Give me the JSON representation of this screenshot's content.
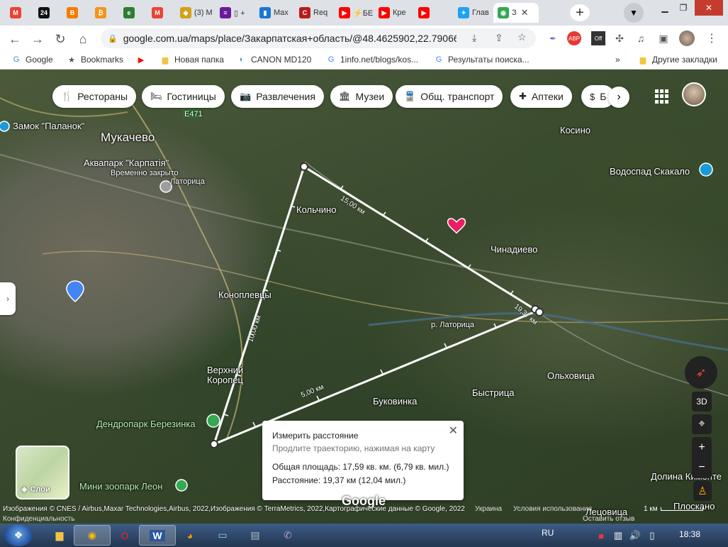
{
  "browser": {
    "tabs": [
      {
        "title": "",
        "favicon": "gmail-icon",
        "color": "#ea4335",
        "glyph": "M"
      },
      {
        "title": "",
        "favicon": "site-24-icon",
        "color": "#111111",
        "glyph": "24"
      },
      {
        "title": "",
        "favicon": "blogger-icon",
        "color": "#f57c00",
        "glyph": "B"
      },
      {
        "title": "",
        "favicon": "bitcoin-icon",
        "color": "#f7931a",
        "glyph": "₿"
      },
      {
        "title": "",
        "favicon": "e-icon",
        "color": "#2e7d32",
        "glyph": "e"
      },
      {
        "title": "",
        "favicon": "gmail-icon",
        "color": "#ea4335",
        "glyph": "M"
      },
      {
        "title": "(3) M",
        "favicon": "shield-icon",
        "color": "#d4a017",
        "glyph": "◆"
      },
      {
        "title": "▯ +",
        "favicon": "list-icon",
        "color": "#6a1b9a",
        "glyph": "≡"
      },
      {
        "title": "Max",
        "favicon": "book-icon",
        "color": "#1976d2",
        "glyph": "▮"
      },
      {
        "title": "Req",
        "favicon": "c-icon",
        "color": "#b71c1c",
        "glyph": "C"
      },
      {
        "title": "⚡БЕЛ",
        "favicon": "youtube-icon",
        "color": "#ff0000",
        "glyph": "▶"
      },
      {
        "title": "Кре",
        "favicon": "youtube-icon",
        "color": "#ff0000",
        "glyph": "▶"
      },
      {
        "title": "",
        "favicon": "youtube-icon",
        "color": "#ff0000",
        "glyph": "▶"
      },
      {
        "title": "Глав",
        "favicon": "twitter-icon",
        "color": "#1da1f2",
        "glyph": "✦"
      },
      {
        "title": "З",
        "favicon": "maps-icon",
        "color": "#34a853",
        "glyph": "◉",
        "active": true
      }
    ],
    "url": "google.com.ua/maps/place/Закарпатская+область/@48.4625902,22.79066...",
    "bookmarks": [
      {
        "label": "Google",
        "icon": "google-icon",
        "color": "#4285f4",
        "glyph": "G"
      },
      {
        "label": "Bookmarks",
        "icon": "star-icon",
        "color": "#555555",
        "glyph": "★"
      },
      {
        "label": "",
        "icon": "youtube-icon",
        "color": "#ff0000",
        "glyph": "▶"
      },
      {
        "label": "Новая папка",
        "icon": "folder-icon",
        "color": "#f4c542",
        "glyph": "▆"
      },
      {
        "label": "CANON MD120",
        "icon": "canon-icon",
        "color": "#29a3e0",
        "glyph": "◐"
      },
      {
        "label": "1info.net/blogs/kos...",
        "icon": "google-icon",
        "color": "#4285f4",
        "glyph": "G"
      },
      {
        "label": "Результаты поиска...",
        "icon": "google-icon",
        "color": "#4285f4",
        "glyph": "G"
      }
    ],
    "bookmarks_more": "»",
    "other_bookmarks": "Другие закладки"
  },
  "map": {
    "chips": [
      {
        "label": "Рестораны",
        "icon": "fork-knife-icon",
        "glyph": "🍴"
      },
      {
        "label": "Гостиницы",
        "icon": "bed-icon",
        "glyph": "🛏"
      },
      {
        "label": "Развлечения",
        "icon": "camera-icon",
        "glyph": "📷"
      },
      {
        "label": "Музеи",
        "icon": "museum-icon",
        "glyph": "🏛"
      },
      {
        "label": "Общ. транспорт",
        "icon": "train-icon",
        "glyph": "🚆"
      },
      {
        "label": "Аптеки",
        "icon": "pharmacy-icon",
        "glyph": "✚"
      },
      {
        "label": "Б",
        "icon": "atm-icon",
        "glyph": "$"
      }
    ],
    "places": [
      {
        "name": "Замок \"Паланок\"",
        "cls": ""
      },
      {
        "name": "Мукачево",
        "cls": "big"
      },
      {
        "name": "Аквапарк \"Карпатія\"",
        "cls": ""
      },
      {
        "name": "Временно закрыто",
        "cls": "small"
      },
      {
        "name": "Латорица",
        "cls": "small"
      },
      {
        "name": "Кольчино",
        "cls": ""
      },
      {
        "name": "Чинадиево",
        "cls": ""
      },
      {
        "name": "Косино",
        "cls": ""
      },
      {
        "name": "Водоспад Скакало",
        "cls": ""
      },
      {
        "name": "Коноплевцы",
        "cls": ""
      },
      {
        "name": "р. Латорица",
        "cls": "small"
      },
      {
        "name": "Верхний",
        "cls": ""
      },
      {
        "name": "Коропец",
        "cls": ""
      },
      {
        "name": "Дендропарк Березинка",
        "cls": "green"
      },
      {
        "name": "Буковинка",
        "cls": ""
      },
      {
        "name": "Быстрица",
        "cls": ""
      },
      {
        "name": "Ольховица",
        "cls": ""
      },
      {
        "name": "Мини зоопарк Леон",
        "cls": "green"
      },
      {
        "name": "Долина Кименте",
        "cls": ""
      },
      {
        "name": "Лецовица",
        "cls": ""
      },
      {
        "name": "Плоскано",
        "cls": ""
      },
      {
        "name": "Е471",
        "cls": "small"
      }
    ],
    "distances": [
      "15,00 км",
      "10,00 км",
      "5,00 км",
      "19,37 км"
    ],
    "layers_label": "Слои",
    "controls": {
      "three_d": "3D",
      "zoom_in": "+",
      "zoom_out": "−"
    },
    "measure": {
      "title": "Измерить расстояние",
      "hint": "Продлите траекторию, нажимая на карту",
      "area": "Общая площадь: 17,59 кв. км. (6,79 кв. мил.)",
      "distance": "Расстояние: 19,37 км (12,04 мил.)"
    },
    "footer": {
      "attribution": "Изображения © CNES / Airbus,Maxar Technologies,Airbus, 2022,Изображения © TerraMetrics, 2022,Картографические данные © Google, 2022",
      "country": "Украина",
      "terms": "Условия использования",
      "feedback": "Оставить отзыв",
      "privacy": "Конфиденциальность",
      "scale": "1 км"
    },
    "logo": "Google"
  },
  "taskbar": {
    "lang": "RU",
    "time": "18:38"
  }
}
